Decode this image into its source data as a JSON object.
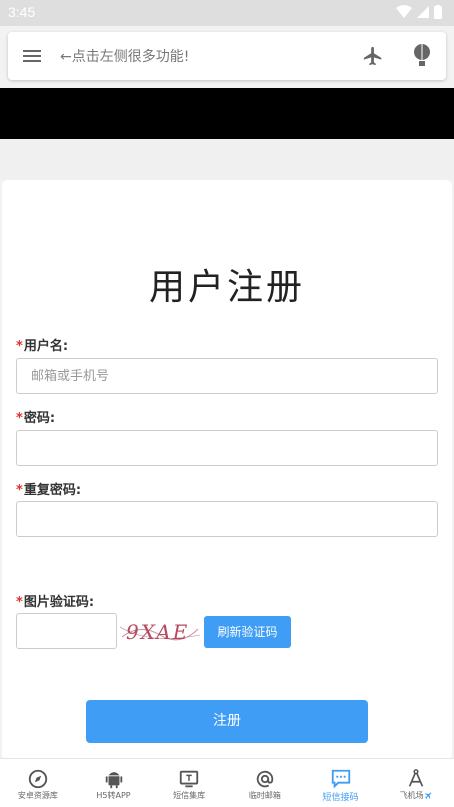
{
  "status": {
    "time": "3:45"
  },
  "appbar": {
    "hint": "←点击左侧很多功能!"
  },
  "form": {
    "title": "用户注册",
    "required_mark": "*",
    "username_label": "用户名:",
    "username_placeholder": "邮箱或手机号",
    "password_label": "密码:",
    "confirm_label": "重复密码:",
    "captcha_label": "图片验证码:",
    "captcha_text": "9XAE",
    "refresh_label": "刷新验证码",
    "submit_label": "注册"
  },
  "tabs": [
    {
      "label": "安卓资源库",
      "icon": "compass-icon"
    },
    {
      "label": "H5转APP",
      "icon": "android-icon"
    },
    {
      "label": "短信集库",
      "icon": "monitor-icon"
    },
    {
      "label": "临时邮箱",
      "icon": "at-icon"
    },
    {
      "label": "短信接码",
      "icon": "chat-icon",
      "active": true
    },
    {
      "label": "飞机场",
      "icon": "compass-draw-icon"
    }
  ],
  "colors": {
    "accent": "#3f9df5",
    "required": "#e03030"
  }
}
